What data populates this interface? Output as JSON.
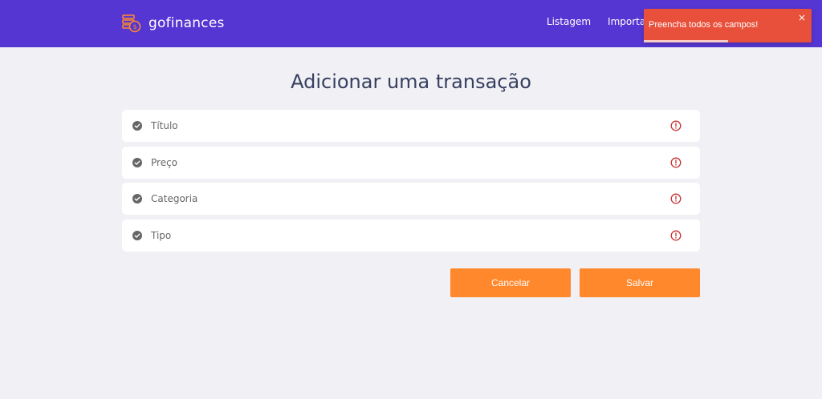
{
  "header": {
    "brand": "gofinances",
    "nav": [
      {
        "label": "Listagem"
      },
      {
        "label": "Importar"
      }
    ]
  },
  "toast": {
    "message": "Preencha todos os campos!",
    "close": "×",
    "progress_fraction": 0.5
  },
  "page": {
    "title": "Adicionar uma transação"
  },
  "form": {
    "fields": [
      {
        "label": "Título"
      },
      {
        "label": "Preço"
      },
      {
        "label": "Categoria"
      },
      {
        "label": "Tipo"
      }
    ],
    "cancel_label": "Cancelar",
    "save_label": "Salvar"
  },
  "colors": {
    "header_bg": "#5636d3",
    "page_bg": "#f0f0f5",
    "accent": "#ff872c",
    "error": "#c53030",
    "toast_bg": "#e8503b"
  },
  "icons": {
    "logo": "money-stack-icon",
    "field_status": "check-circle-icon",
    "field_error": "alert-circle-icon"
  }
}
